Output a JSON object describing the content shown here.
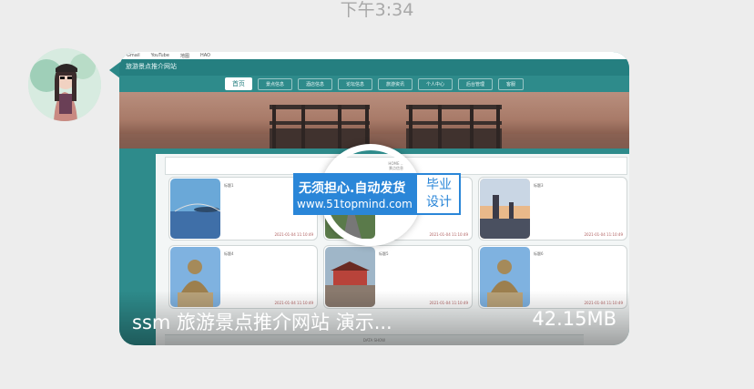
{
  "chat": {
    "timestamp": "下午3:34",
    "video_caption": "ssm 旅游景点推介网站 演示...",
    "video_size": "42.15MB"
  },
  "preview": {
    "bookmarks": [
      "Gmail",
      "YouTube",
      "地图",
      "HAO"
    ],
    "site_title": "旅游景点推介网站",
    "nav": [
      "首页",
      "景点信息",
      "酒店信息",
      "论坛信息",
      "旅游资讯",
      "个人中心",
      "后台管理",
      "客服"
    ],
    "section_header_en": "HOME ...",
    "section_header_zh": "景点信息",
    "items": [
      {
        "title": "标题1",
        "date": "2021-01-04 11:10:49",
        "theme": "lake"
      },
      {
        "title": "标题2",
        "date": "2021-01-04 11:10:49",
        "theme": "road"
      },
      {
        "title": "标题3",
        "date": "2021-01-04 11:10:49",
        "theme": "pagoda"
      },
      {
        "title": "标题4",
        "date": "2021-01-04 11:10:49",
        "theme": "buddha"
      },
      {
        "title": "标题5",
        "date": "2021-01-04 11:10:49",
        "theme": "palace"
      },
      {
        "title": "标题6",
        "date": "2021-01-04 11:10:49",
        "theme": "buddha"
      }
    ],
    "footer_strip": "DATA SHOW"
  },
  "watermark": {
    "line1": "无须担心.自动发货",
    "line2": "www.51topmind.com",
    "badge_line1": "毕业",
    "badge_line2": "设计"
  },
  "colors": {
    "teal": "#2e8b8b",
    "watermark_blue": "#2a86d8",
    "background": "#ededed"
  }
}
